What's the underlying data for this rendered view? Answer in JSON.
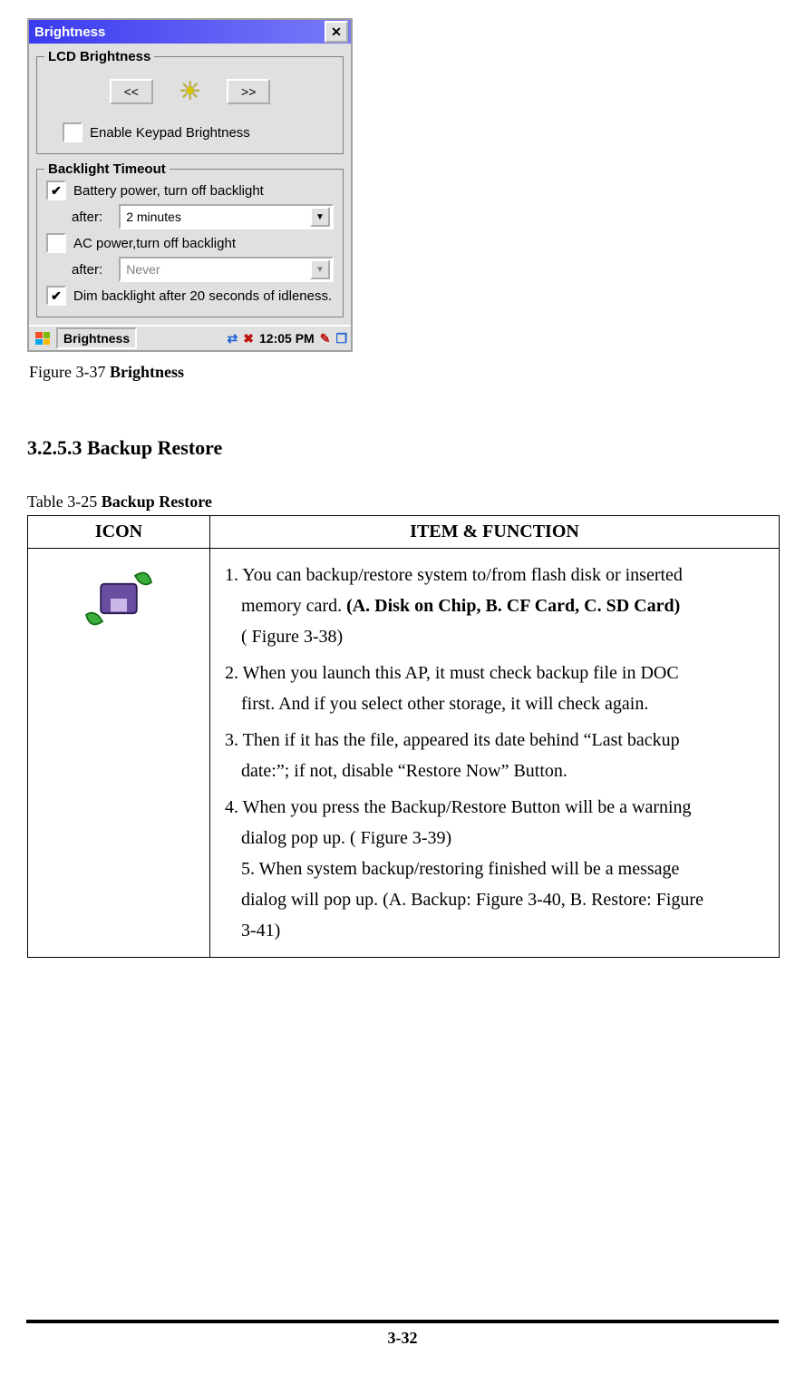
{
  "dialog": {
    "title": "Brightness",
    "lcd_legend": "LCD Brightness",
    "btn_left": "<<",
    "btn_right": ">>",
    "enable_keypad_label": "Enable Keypad Brightness",
    "backlight_legend": "Backlight Timeout",
    "battery_label": "Battery power, turn off backlight",
    "after_label1": "after:",
    "after_label2": "after:",
    "battery_after_value": "2 minutes",
    "ac_label": "AC  power,turn off backlight",
    "ac_after_value": "Never",
    "dim_label": "Dim backlight after 20 seconds of idleness.",
    "taskbar_app": "Brightness",
    "taskbar_time": "12:05 PM"
  },
  "figure_caption_prefix": "Figure 3-37 ",
  "figure_caption_bold": "Brightness",
  "section_heading": "3.2.5.3 Backup Restore",
  "table_caption_prefix": "Table 3-25 ",
  "table_caption_bold": "Backup Restore",
  "table_headers": {
    "icon": "ICON",
    "func": "ITEM & FUNCTION"
  },
  "func_items": {
    "i1a": "1. You can backup/restore system to/from flash disk or inserted",
    "i1b": "memory card. ",
    "i1bold": "(A. Disk on Chip, B. CF Card, C. SD Card)",
    "i1c": "( Figure 3-38)",
    "i2a": "2. When you launch this AP, it must check backup file in DOC",
    "i2b": "first. And if you select other storage, it will check again.",
    "i3a": "3. Then if it has the file, appeared its date behind “Last backup",
    "i3b": "date:”; if not, disable “Restore Now” Button.",
    "i4a": "4. When you press the Backup/Restore Button will be a warning",
    "i4b": "dialog pop up. ( Figure 3-39)",
    "i5a": "5. When system backup/restoring finished will be a message",
    "i5b": "dialog will pop up. (A. Backup: Figure 3-40, B. Restore: Figure",
    "i5c": "3-41)"
  },
  "page_number": "3-32"
}
